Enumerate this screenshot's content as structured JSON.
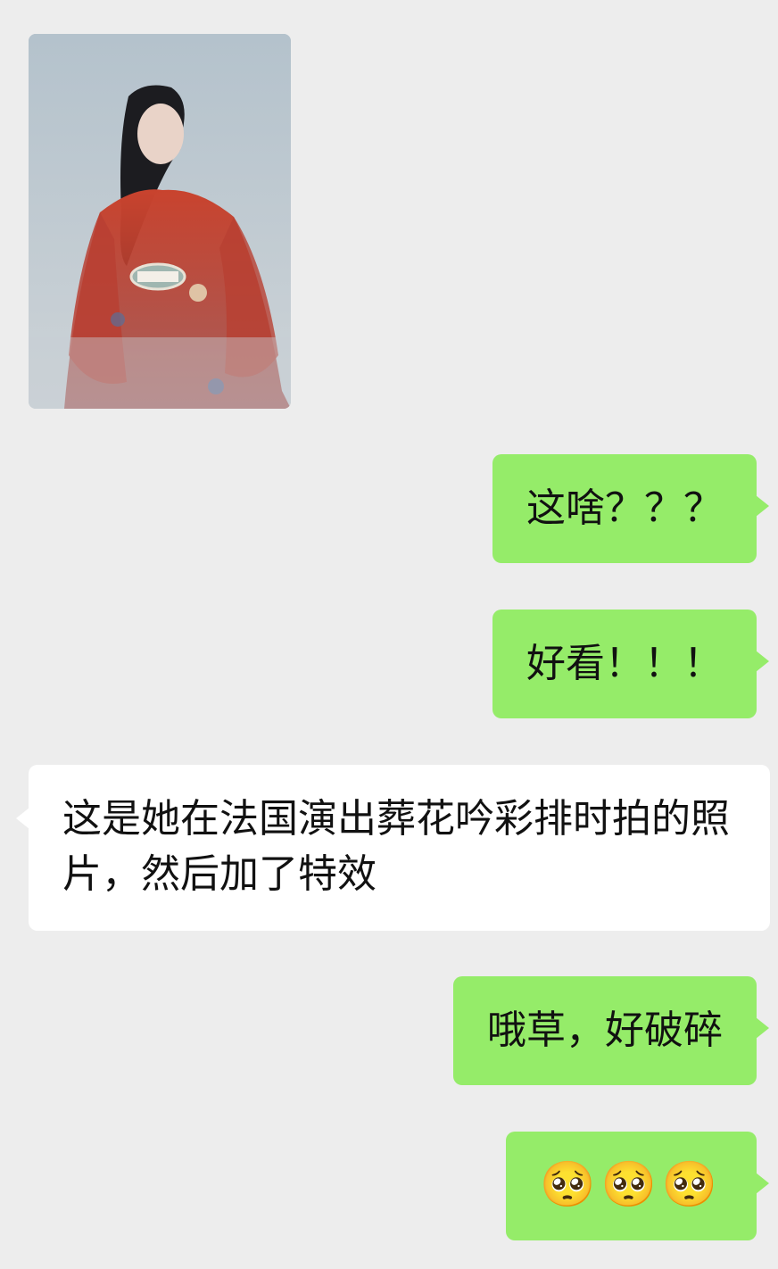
{
  "messages": [
    {
      "from": "other",
      "type": "image"
    },
    {
      "from": "me",
      "text": "这啥？？？"
    },
    {
      "from": "me",
      "text": "好看！！！"
    },
    {
      "from": "other",
      "text": "这是她在法国演出葬花吟彩排时拍的照片，然后加了特效"
    },
    {
      "from": "me",
      "text": "哦草，好破碎"
    },
    {
      "from": "me",
      "text": "🥺🥺🥺"
    }
  ],
  "colors": {
    "background": "#ededed",
    "outgoing_bubble": "#95ec69",
    "incoming_bubble": "#ffffff"
  }
}
